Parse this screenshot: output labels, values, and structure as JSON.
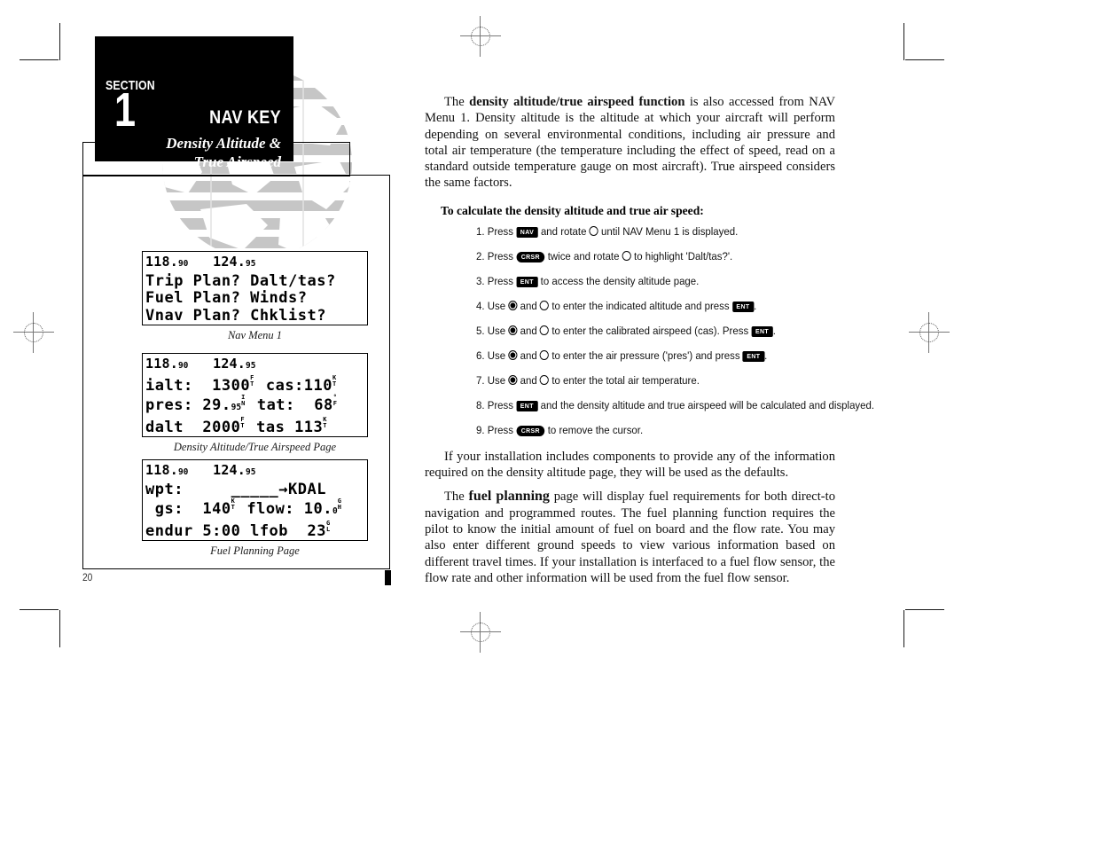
{
  "section": {
    "label": "SECTION",
    "number": "1",
    "title": "NAV KEY",
    "subtitle_line1": "Density Altitude &",
    "subtitle_line2": "True Airspeed"
  },
  "page": {
    "number": "20"
  },
  "figures": [
    {
      "name": "nav-menu-1",
      "caption": "Nav Menu 1",
      "rows": [
        {
          "type": "freq",
          "left_whole": "118.",
          "left_dec": "90",
          "right_whole": "124.",
          "right_dec": "95"
        },
        {
          "type": "text",
          "text": "Trip Plan? Dalt/tas?"
        },
        {
          "type": "text",
          "text": "Fuel Plan? Winds?"
        },
        {
          "type": "text",
          "text": "Vnav Plan? Chklist?"
        }
      ]
    },
    {
      "name": "density-altitude-true-airspeed-page",
      "caption": "Density Altitude/True Airspeed Page",
      "rows": [
        {
          "type": "freq",
          "left_whole": "118.",
          "left_dec": "90",
          "right_whole": "124.",
          "right_dec": "95"
        },
        {
          "type": "fields",
          "cells": [
            {
              "label": "ialt: ",
              "value": " 1300",
              "unit_top": "F",
              "unit_bot": "T"
            },
            {
              "label": " cas:",
              "value": "110",
              "unit_top": "K",
              "unit_bot": "T"
            }
          ]
        },
        {
          "type": "fields",
          "cells": [
            {
              "label": "pres: ",
              "value": "29.",
              "sub": "95",
              "unit_top": "I",
              "unit_bot": "N"
            },
            {
              "label": " tat: ",
              "value": " 68",
              "unit_top": "°",
              "unit_bot": "F"
            }
          ]
        },
        {
          "type": "fields",
          "cells": [
            {
              "label": "dalt ",
              "value": " 2000",
              "unit_top": "F",
              "unit_bot": "T"
            },
            {
              "label": " tas ",
              "value": "113",
              "unit_top": "K",
              "unit_bot": "T"
            }
          ]
        }
      ]
    },
    {
      "name": "fuel-planning-page",
      "caption": "Fuel Planning Page",
      "rows": [
        {
          "type": "freq",
          "left_whole": "118.",
          "left_dec": "90",
          "right_whole": "124.",
          "right_dec": "95"
        },
        {
          "type": "text",
          "text": "wpt:     _____→KDAL"
        },
        {
          "type": "fields",
          "cells": [
            {
              "label": " gs:  140",
              "value": "",
              "unit_top": "K",
              "unit_bot": "T"
            },
            {
              "label": " flow: 10.",
              "value": "",
              "sub": "0",
              "unit_top": "G",
              "unit_bot": "H"
            }
          ]
        },
        {
          "type": "fields",
          "cells": [
            {
              "label": "endur 5:00 lfob",
              "value": "  23",
              "sub": "",
              "unit_top": "G",
              "unit_bot": "L"
            }
          ]
        }
      ]
    }
  ],
  "body": {
    "para1": {
      "lead": "The ",
      "bold": "density altitude/true airspeed function",
      "rest": " is also accessed from NAV Menu 1. Density altitude is the altitude at which your aircraft will perform depending on several environmental conditions, including air pressure and total air temperature (the temperature including the effect of speed, read on a standard outside temperature gauge on most aircraft). True airspeed considers the same factors."
    },
    "steps_title": "To calculate the density altitude and true air speed:",
    "steps": [
      {
        "num": "1. Press ",
        "key1": "NAV",
        "key1_shape": "rect",
        "mid": " and rotate ",
        "knob": "open",
        "tail": " until NAV Menu 1 is displayed."
      },
      {
        "num": "2. Press ",
        "key1": "CRSR",
        "key1_shape": "pill",
        "mid": " twice and rotate ",
        "knob": "open",
        "tail": " to highlight 'Dalt/tas?'."
      },
      {
        "num": "3. Press ",
        "key1": "ENT",
        "key1_shape": "rect",
        "mid": "",
        "knob": "",
        "tail": " to access the density altitude page."
      },
      {
        "num": "4. Use ",
        "knob_a": "solid",
        "mid": " and ",
        "knob_b": "open",
        "tail": " to enter the indicated altitude and press ",
        "key2": "ENT",
        "end": "."
      },
      {
        "num": "5. Use ",
        "knob_a": "solid",
        "mid": " and ",
        "knob_b": "open",
        "tail": " to enter the calibrated airspeed (cas). Press ",
        "key2": "ENT",
        "end": "."
      },
      {
        "num": "6. Use ",
        "knob_a": "solid",
        "mid": " and ",
        "knob_b": "open",
        "tail": " to enter the air pressure ('pres') and press ",
        "key2": "ENT",
        "end": "."
      },
      {
        "num": "7. Use ",
        "knob_a": "solid",
        "mid": " and ",
        "knob_b": "open",
        "tail": " to enter the total air temperature.",
        "key2": "",
        "end": ""
      },
      {
        "num": "8. Press ",
        "key1": "ENT",
        "key1_shape": "rect",
        "mid": "",
        "knob": "",
        "tail": " and the density altitude and true airspeed will be calculated and displayed."
      },
      {
        "num": "9. Press ",
        "key1": "CRSR",
        "key1_shape": "pill",
        "mid": "",
        "knob": "",
        "tail": " to remove the cursor."
      }
    ],
    "para2": "If your installation includes components to provide any of the information required on the density altitude page, they will be used as the defaults.",
    "para3": {
      "lead": "The ",
      "bold": "fuel planning",
      "rest": " page will display fuel requirements for both direct-to navigation and programmed routes. The fuel planning function requires the pilot to know the initial amount of fuel on board and the flow rate. You may also enter different ground speeds to view various information based on different travel times. If your installation is interfaced to a fuel flow sensor, the flow rate and other information will be used from the fuel flow sensor."
    }
  },
  "colors": {
    "ink": "#000000",
    "watermark": "#c6c6c6"
  }
}
